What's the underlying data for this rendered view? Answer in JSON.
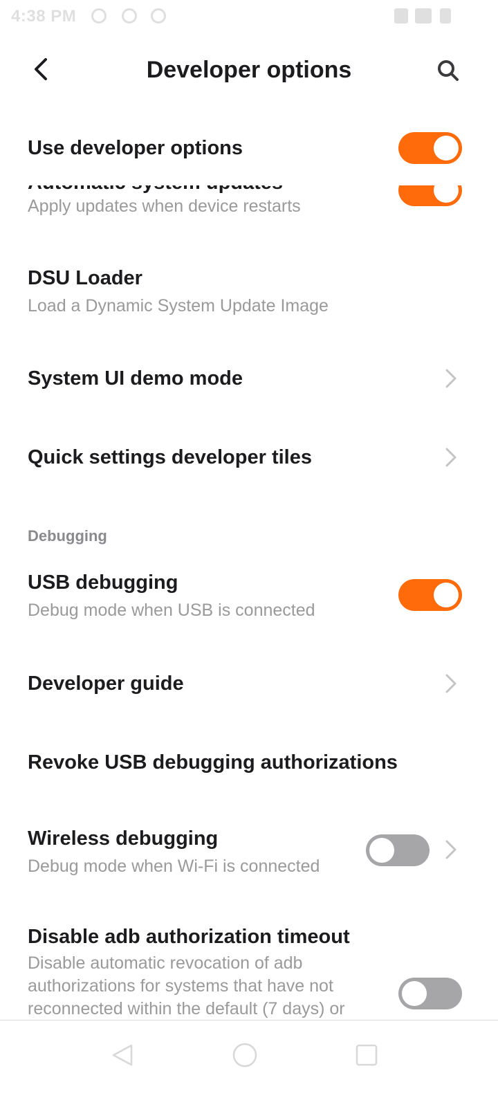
{
  "status_bar": {
    "time": "4:38 PM"
  },
  "header": {
    "title": "Developer options"
  },
  "master": {
    "label": "Use developer options",
    "enabled": true
  },
  "partial_item": {
    "title": "Automatic system updates",
    "subtitle": "Apply updates when device restarts",
    "enabled": true
  },
  "items": {
    "dsu": {
      "title": "DSU Loader",
      "subtitle": "Load a Dynamic System Update Image"
    },
    "demo": {
      "title": "System UI demo mode"
    },
    "tiles": {
      "title": "Quick settings developer tiles"
    }
  },
  "sections": {
    "debugging": "Debugging"
  },
  "debugging": {
    "usb": {
      "title": "USB debugging",
      "subtitle": "Debug mode when USB is connected",
      "enabled": true
    },
    "guide": {
      "title": "Developer guide"
    },
    "revoke": {
      "title": "Revoke USB debugging authorizations"
    },
    "wireless": {
      "title": "Wireless debugging",
      "subtitle": "Debug mode when Wi-Fi is connected",
      "enabled": false
    },
    "adb_timeout": {
      "title": "Disable adb authorization timeout",
      "subtitle": "Disable automatic revocation of adb authorizations for systems that have not reconnected within the default (7 days) or",
      "enabled": false
    }
  },
  "icons": {
    "back": "back-arrow-icon",
    "search": "search-icon",
    "chevron": "chevron-right-icon",
    "nav_back": "nav-back-icon",
    "nav_home": "nav-home-icon",
    "nav_recents": "nav-recents-icon"
  },
  "colors": {
    "accent": "#ff6a0b",
    "toggle_off": "#a6a6a9",
    "subtitle": "#9a9a9a",
    "title": "#1c1c1e"
  }
}
